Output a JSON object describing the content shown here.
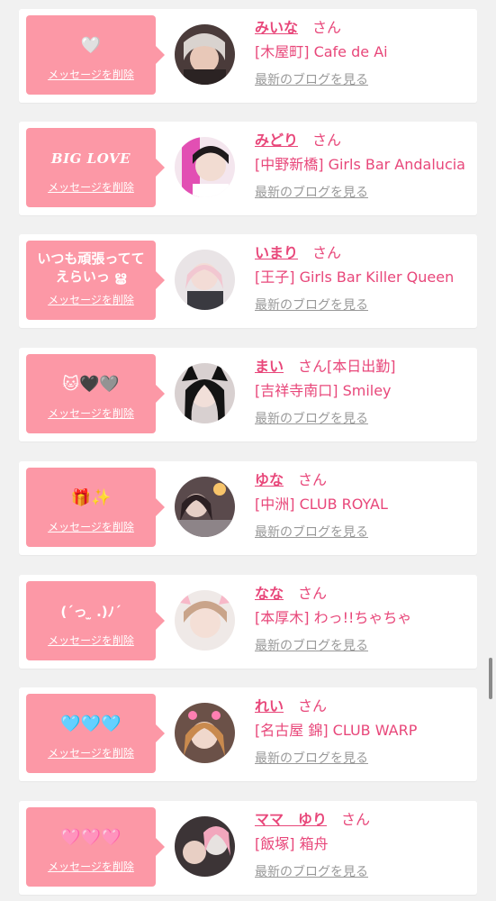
{
  "ui": {
    "delete_label": "メッセージを削除",
    "honorific": "さん",
    "blog_label": "最新のブログを見る"
  },
  "entries": [
    {
      "message": "🤍",
      "name": "みいな",
      "status": "",
      "shop": "[木屋町] Cafe de Ai"
    },
    {
      "message": "BIG LOVE",
      "name": "みどり",
      "status": "",
      "shop": "[中野新橋] Girls Bar Andalucia"
    },
    {
      "message": "いつも頑張ってて えらいっ ൠ",
      "name": "いまり",
      "status": "",
      "shop": "[王子] Girls Bar Killer Queen"
    },
    {
      "message": "🐱🖤🩶",
      "name": "まい",
      "status": "[本日出勤]",
      "shop": "[吉祥寺南口] Smiley"
    },
    {
      "message": "🎁✨",
      "name": "ゆな",
      "status": "",
      "shop": "[中洲] CLUB ROYAL"
    },
    {
      "message": "(´っ ̫ .)ﾉ´",
      "name": "なな",
      "status": "",
      "shop": "[本厚木] わっ!!ちゃちゃ"
    },
    {
      "message": "🩵🩵🩵",
      "name": "れい",
      "status": "",
      "shop": "[名古屋 錦] CLUB WARP"
    },
    {
      "message": "🩷🩷🩷",
      "name": "ママ　ゆり",
      "status": "",
      "shop": "[飯塚] 箱舟"
    }
  ]
}
